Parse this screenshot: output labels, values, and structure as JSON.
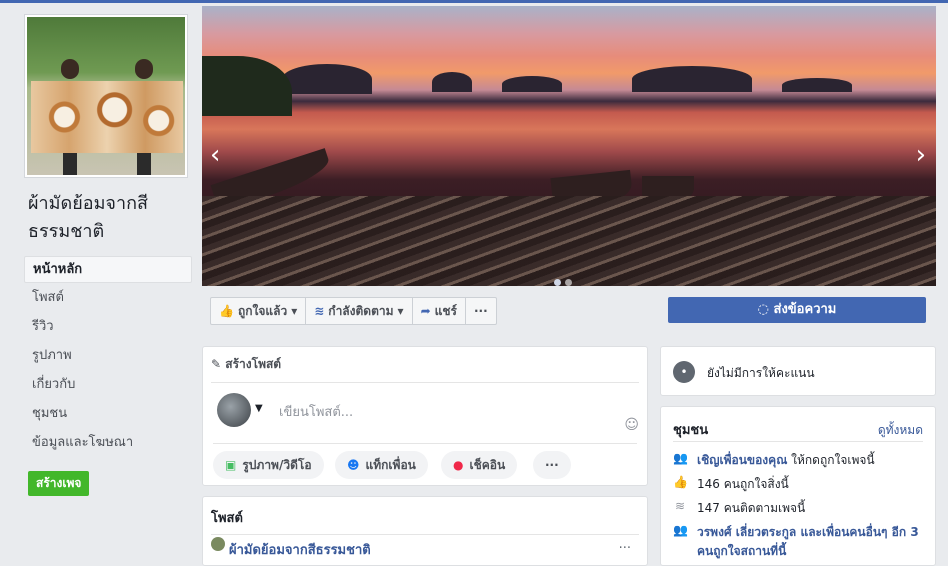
{
  "page": {
    "name": "ผ้ามัดย้อมจากสีธรรมชาติ"
  },
  "nav": {
    "items": [
      {
        "label": "หน้าหลัก"
      },
      {
        "label": "โพสต์"
      },
      {
        "label": "รีวิว"
      },
      {
        "label": "รูปภาพ"
      },
      {
        "label": "เกี่ยวกับ"
      },
      {
        "label": "ชุมชน"
      },
      {
        "label": "ข้อมูลและโฆษณา"
      }
    ],
    "create_page": "สร้างเพจ"
  },
  "actions": {
    "like": "ถูกใจแล้ว",
    "follow": "กำลังติดตาม",
    "share": "แชร์",
    "more": "···",
    "send_message": "ส่งข้อความ"
  },
  "create_post": {
    "title": "สร้างโพสต์",
    "placeholder": "เขียนโพสต์...",
    "photo": "รูปภาพ/วิดีโอ",
    "tag": "แท็กเพื่อน",
    "checkin": "เช็คอิน",
    "more": "···"
  },
  "posts": {
    "title": "โพสต์",
    "author": "ผ้ามัดย้อมจากสีธรรมชาติ",
    "more": "···"
  },
  "rating": {
    "text": "ยังไม่มีการให้คะแนน"
  },
  "community": {
    "title": "ชุมชน",
    "see_all": "ดูทั้งหมด",
    "invite_link": "เชิญเพื่อนของคุณ",
    "invite_rest": " ให้กดถูกใจเพจนี้",
    "likes": "146 คนถูกใจสิ่งนี้",
    "follows": "147 คนติดตามเพจนี้",
    "friends": "วรพงศ์ เลี่ยวตระกูล และเพื่อนคนอื่นๆ อีก 3 คนถูกใจสถานที่นี้"
  },
  "colors": {
    "brand": "#4267b2",
    "create_page": "#42b72a"
  }
}
